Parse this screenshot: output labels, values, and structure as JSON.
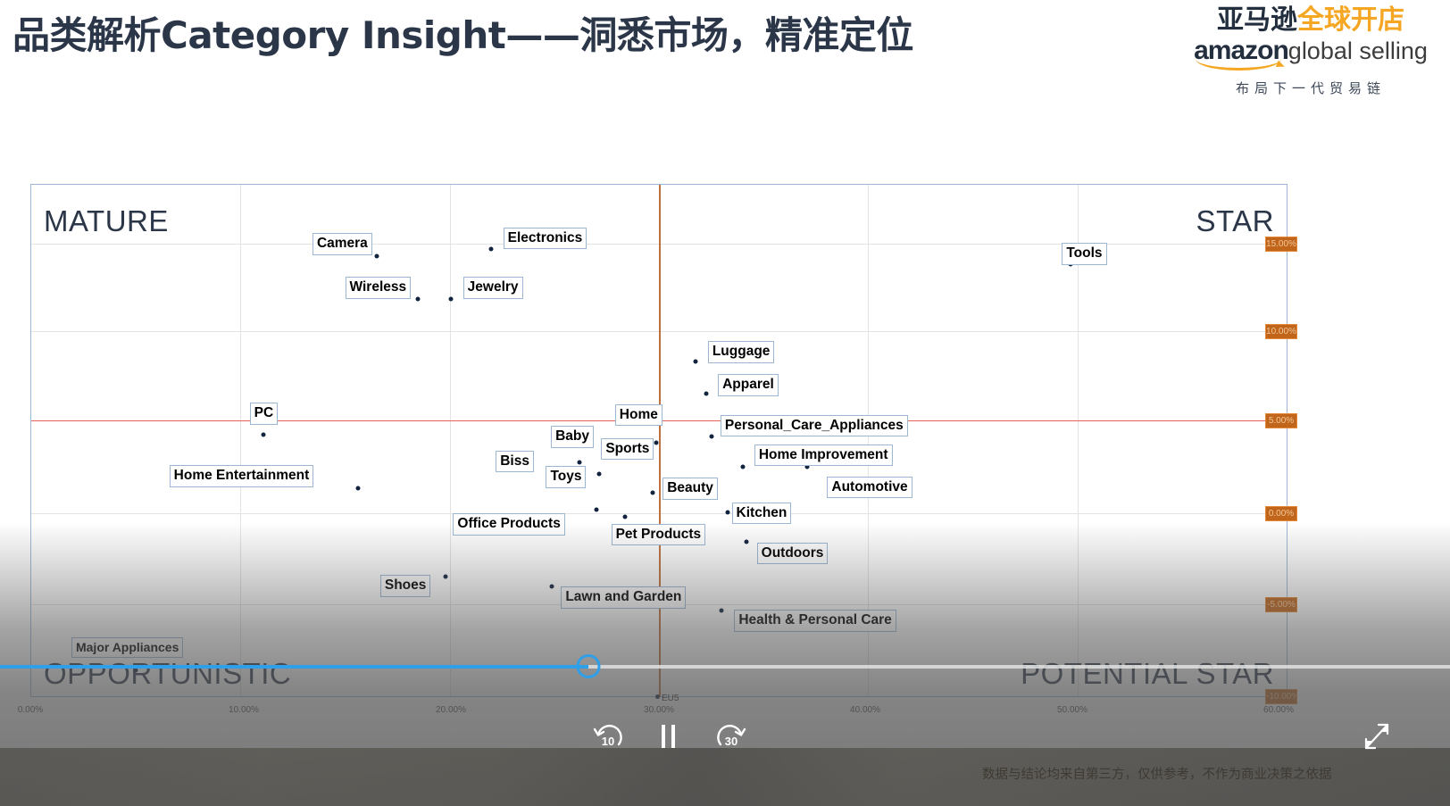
{
  "header": {
    "title": "品类解析Category Insight——洞悉市场，精准定位",
    "logo": {
      "cn_dark": "亚马逊",
      "cn_orange": "全球开店",
      "amazon": "amazon",
      "global_selling": "global selling",
      "tagline": "布局下一代贸易链"
    }
  },
  "quadrants": {
    "top_left": "MATURE",
    "top_right": "STAR",
    "bottom_left": "OPPORTUNISTIC",
    "bottom_right": "POTENTIAL STAR"
  },
  "axis": {
    "x_ticks": [
      "0.00%",
      "10.00%",
      "20.00%",
      "30.00%",
      "40.00%",
      "50.00%",
      "60.00%"
    ],
    "x_values": [
      0,
      10,
      20,
      30,
      40,
      50,
      60
    ],
    "y_badges": [
      "15.00%",
      "10.00%",
      "5.00%",
      "0.00%",
      "-5.00%",
      "-10.00%"
    ],
    "eu5_marker": {
      "label": "EU5",
      "value": "30.00%"
    }
  },
  "colors": {
    "accent_orange": "#f5a623",
    "amazon_dark": "#232f3e",
    "avg_line_red": "#e8605a",
    "eu5_line_brown": "#c0703c",
    "point_navy": "#12233f",
    "label_border_blue": "#9cb7d4",
    "progress_blue": "#2e9fe8",
    "badge_orange": "#c1651b"
  },
  "chart_data": {
    "type": "scatter",
    "title": "品类解析Category Insight——洞悉市场，精准定位",
    "xlabel": "",
    "ylabel": "",
    "xlim": [
      0,
      62
    ],
    "ylim": [
      -12,
      17
    ],
    "grid": true,
    "legend": "none",
    "reference_lines": {
      "vertical_eu5_x": 30.0,
      "horizontal_average_y": 5.0
    },
    "points": [
      {
        "name": "Camera",
        "x": 16.5,
        "y": 12.7
      },
      {
        "name": "Electronics",
        "x": 22.1,
        "y": 13.4
      },
      {
        "name": "Wireless",
        "x": 18.4,
        "y": 11.1
      },
      {
        "name": "Jewelry",
        "x": 20.1,
        "y": 11.1
      },
      {
        "name": "Tools",
        "x": 49.6,
        "y": 11.9
      },
      {
        "name": "Luggage",
        "x": 31.7,
        "y": 8.1
      },
      {
        "name": "Apparel",
        "x": 32.2,
        "y": 6.9
      },
      {
        "name": "PC",
        "x": 11.1,
        "y": 4.4
      },
      {
        "name": "Home",
        "x": 30.0,
        "y": 5.4
      },
      {
        "name": "Personal_Care_Appliances",
        "x": 32.5,
        "y": 4.4
      },
      {
        "name": "Baby",
        "x": 27.7,
        "y": 4.0
      },
      {
        "name": "Sports",
        "x": 29.9,
        "y": 4.2
      },
      {
        "name": "Home Improvement",
        "x": 34.0,
        "y": 3.3
      },
      {
        "name": "Biss",
        "x": 26.2,
        "y": 3.4
      },
      {
        "name": "Toys",
        "x": 27.1,
        "y": 3.0
      },
      {
        "name": "Automotive",
        "x": 37.1,
        "y": 3.4
      },
      {
        "name": "Home Entertainment",
        "x": 15.6,
        "y": 2.2
      },
      {
        "name": "Beauty",
        "x": 29.7,
        "y": 2.3
      },
      {
        "name": "Office Products",
        "x": 27.0,
        "y": 1.5
      },
      {
        "name": "Kitchen",
        "x": 33.3,
        "y": 1.4
      },
      {
        "name": "Pet Products",
        "x": 28.4,
        "y": 1.2
      },
      {
        "name": "Outdoors",
        "x": 34.2,
        "y": 0.2
      },
      {
        "name": "Shoes",
        "x": 19.8,
        "y": -1.3
      },
      {
        "name": "Lawn and Garden",
        "x": 24.9,
        "y": -1.7
      },
      {
        "name": "Health & Personal Care",
        "x": 33.0,
        "y": -2.8
      },
      {
        "name": "Major Appliances",
        "x": 5.0,
        "y": -5.6
      }
    ]
  },
  "player": {
    "rewind_label": "10",
    "forward_label": "30",
    "state": "playing",
    "progress_percent": 40.6
  },
  "footer": {
    "disclaimer": "数据与结论均来自第三方，仅供参考，不作为商业决策之依据"
  }
}
